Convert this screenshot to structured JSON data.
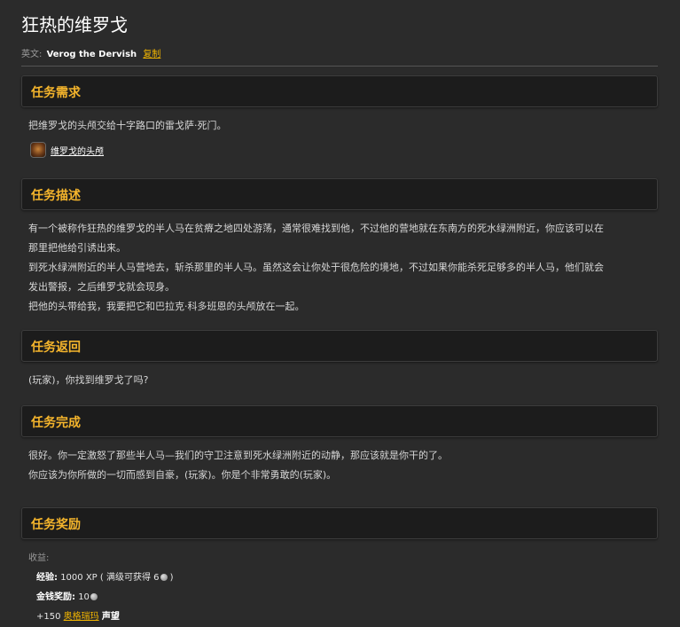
{
  "quest": {
    "title": "狂热的维罗戈",
    "english_label": "英文:",
    "english_name": "Verog the Dervish",
    "copy_label": "复制"
  },
  "sections": {
    "requirements": {
      "heading": "任务需求",
      "text": "把维罗戈的头颅交给十字路口的雷戈萨·死门。",
      "item": {
        "name": "维罗戈的头颅",
        "icon": "quest-item-icon"
      }
    },
    "description": {
      "heading": "任务描述",
      "lines": [
        "有一个被称作狂热的维罗戈的半人马在贫瘠之地四处游荡，通常很难找到他，不过他的营地就在东南方的死水绿洲附近，你应该可以在",
        "那里把他给引诱出来。",
        "到死水绿洲附近的半人马营地去，斩杀那里的半人马。虽然这会让你处于很危险的境地，不过如果你能杀死足够多的半人马，他们就会",
        "发出警报，之后维罗戈就会现身。",
        "把他的头带给我，我要把它和巴拉克·科多班恩的头颅放在一起。"
      ]
    },
    "return": {
      "heading": "任务返回",
      "text": "(玩家)，你找到维罗戈了吗?"
    },
    "complete": {
      "heading": "任务完成",
      "lines": [
        "很好。你一定激怒了那些半人马—我们的守卫注意到死水绿洲附近的动静，那应该就是你干的了。",
        "你应该为你所做的一切而感到自豪，(玩家)。你是个非常勇敢的(玩家)。"
      ]
    },
    "rewards": {
      "heading": "任务奖励",
      "gain_label": "收益:",
      "xp_label": "经验:",
      "xp_value": "1000 XP ( 满级可获得 6",
      "xp_tail": " )",
      "money_label": "金钱奖励:",
      "money_value": "10",
      "rep_prefix": "+150",
      "rep_faction": "奥格瑞玛",
      "rep_suffix": "声望",
      "coin_icon": "silver-coin-icon"
    }
  }
}
